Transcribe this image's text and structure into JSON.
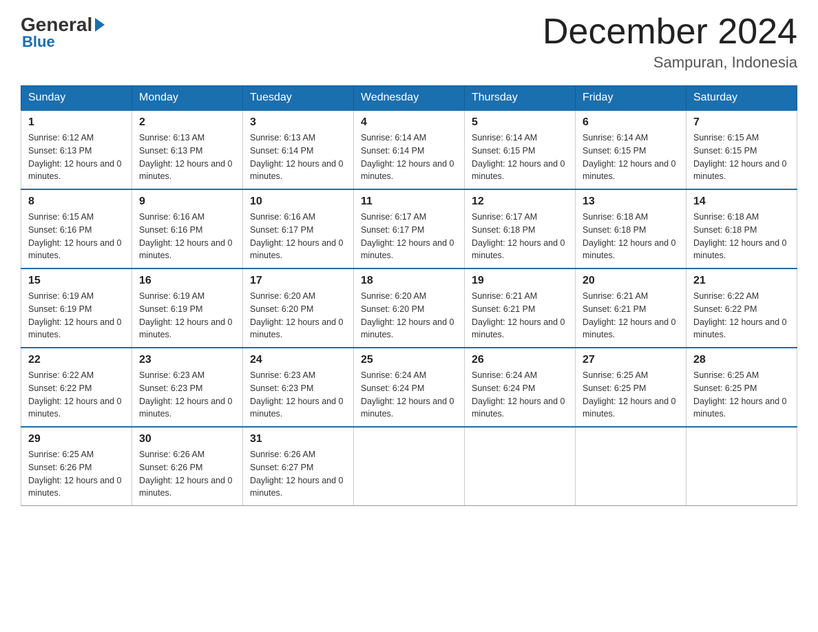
{
  "header": {
    "logo_general": "General",
    "logo_blue": "Blue",
    "month_title": "December 2024",
    "location": "Sampuran, Indonesia"
  },
  "weekdays": [
    "Sunday",
    "Monday",
    "Tuesday",
    "Wednesday",
    "Thursday",
    "Friday",
    "Saturday"
  ],
  "weeks": [
    [
      {
        "day": "1",
        "sunrise": "6:12 AM",
        "sunset": "6:13 PM",
        "daylight": "12 hours and 0 minutes."
      },
      {
        "day": "2",
        "sunrise": "6:13 AM",
        "sunset": "6:13 PM",
        "daylight": "12 hours and 0 minutes."
      },
      {
        "day": "3",
        "sunrise": "6:13 AM",
        "sunset": "6:14 PM",
        "daylight": "12 hours and 0 minutes."
      },
      {
        "day": "4",
        "sunrise": "6:14 AM",
        "sunset": "6:14 PM",
        "daylight": "12 hours and 0 minutes."
      },
      {
        "day": "5",
        "sunrise": "6:14 AM",
        "sunset": "6:15 PM",
        "daylight": "12 hours and 0 minutes."
      },
      {
        "day": "6",
        "sunrise": "6:14 AM",
        "sunset": "6:15 PM",
        "daylight": "12 hours and 0 minutes."
      },
      {
        "day": "7",
        "sunrise": "6:15 AM",
        "sunset": "6:15 PM",
        "daylight": "12 hours and 0 minutes."
      }
    ],
    [
      {
        "day": "8",
        "sunrise": "6:15 AM",
        "sunset": "6:16 PM",
        "daylight": "12 hours and 0 minutes."
      },
      {
        "day": "9",
        "sunrise": "6:16 AM",
        "sunset": "6:16 PM",
        "daylight": "12 hours and 0 minutes."
      },
      {
        "day": "10",
        "sunrise": "6:16 AM",
        "sunset": "6:17 PM",
        "daylight": "12 hours and 0 minutes."
      },
      {
        "day": "11",
        "sunrise": "6:17 AM",
        "sunset": "6:17 PM",
        "daylight": "12 hours and 0 minutes."
      },
      {
        "day": "12",
        "sunrise": "6:17 AM",
        "sunset": "6:18 PM",
        "daylight": "12 hours and 0 minutes."
      },
      {
        "day": "13",
        "sunrise": "6:18 AM",
        "sunset": "6:18 PM",
        "daylight": "12 hours and 0 minutes."
      },
      {
        "day": "14",
        "sunrise": "6:18 AM",
        "sunset": "6:18 PM",
        "daylight": "12 hours and 0 minutes."
      }
    ],
    [
      {
        "day": "15",
        "sunrise": "6:19 AM",
        "sunset": "6:19 PM",
        "daylight": "12 hours and 0 minutes."
      },
      {
        "day": "16",
        "sunrise": "6:19 AM",
        "sunset": "6:19 PM",
        "daylight": "12 hours and 0 minutes."
      },
      {
        "day": "17",
        "sunrise": "6:20 AM",
        "sunset": "6:20 PM",
        "daylight": "12 hours and 0 minutes."
      },
      {
        "day": "18",
        "sunrise": "6:20 AM",
        "sunset": "6:20 PM",
        "daylight": "12 hours and 0 minutes."
      },
      {
        "day": "19",
        "sunrise": "6:21 AM",
        "sunset": "6:21 PM",
        "daylight": "12 hours and 0 minutes."
      },
      {
        "day": "20",
        "sunrise": "6:21 AM",
        "sunset": "6:21 PM",
        "daylight": "12 hours and 0 minutes."
      },
      {
        "day": "21",
        "sunrise": "6:22 AM",
        "sunset": "6:22 PM",
        "daylight": "12 hours and 0 minutes."
      }
    ],
    [
      {
        "day": "22",
        "sunrise": "6:22 AM",
        "sunset": "6:22 PM",
        "daylight": "12 hours and 0 minutes."
      },
      {
        "day": "23",
        "sunrise": "6:23 AM",
        "sunset": "6:23 PM",
        "daylight": "12 hours and 0 minutes."
      },
      {
        "day": "24",
        "sunrise": "6:23 AM",
        "sunset": "6:23 PM",
        "daylight": "12 hours and 0 minutes."
      },
      {
        "day": "25",
        "sunrise": "6:24 AM",
        "sunset": "6:24 PM",
        "daylight": "12 hours and 0 minutes."
      },
      {
        "day": "26",
        "sunrise": "6:24 AM",
        "sunset": "6:24 PM",
        "daylight": "12 hours and 0 minutes."
      },
      {
        "day": "27",
        "sunrise": "6:25 AM",
        "sunset": "6:25 PM",
        "daylight": "12 hours and 0 minutes."
      },
      {
        "day": "28",
        "sunrise": "6:25 AM",
        "sunset": "6:25 PM",
        "daylight": "12 hours and 0 minutes."
      }
    ],
    [
      {
        "day": "29",
        "sunrise": "6:25 AM",
        "sunset": "6:26 PM",
        "daylight": "12 hours and 0 minutes."
      },
      {
        "day": "30",
        "sunrise": "6:26 AM",
        "sunset": "6:26 PM",
        "daylight": "12 hours and 0 minutes."
      },
      {
        "day": "31",
        "sunrise": "6:26 AM",
        "sunset": "6:27 PM",
        "daylight": "12 hours and 0 minutes."
      },
      null,
      null,
      null,
      null
    ]
  ]
}
